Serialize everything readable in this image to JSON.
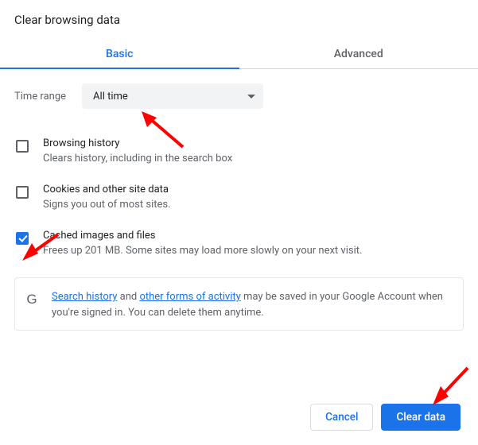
{
  "title": "Clear browsing data",
  "tabs": {
    "basic": "Basic",
    "advanced": "Advanced"
  },
  "time": {
    "label": "Time range",
    "value": "All time"
  },
  "options": [
    {
      "title": "Browsing history",
      "sub": "Clears history, including in the search box",
      "checked": false
    },
    {
      "title": "Cookies and other site data",
      "sub": "Signs you out of most sites.",
      "checked": false
    },
    {
      "title": "Cached images and files",
      "sub": "Frees up 201 MB. Some sites may load more slowly on your next visit.",
      "checked": true
    }
  ],
  "info": {
    "link1": "Search history",
    "mid1": " and ",
    "link2": "other forms of activity",
    "rest": " may be saved in your Google Account when you're signed in. You can delete them anytime."
  },
  "buttons": {
    "cancel": "Cancel",
    "clear": "Clear data"
  },
  "g_logo": "G"
}
